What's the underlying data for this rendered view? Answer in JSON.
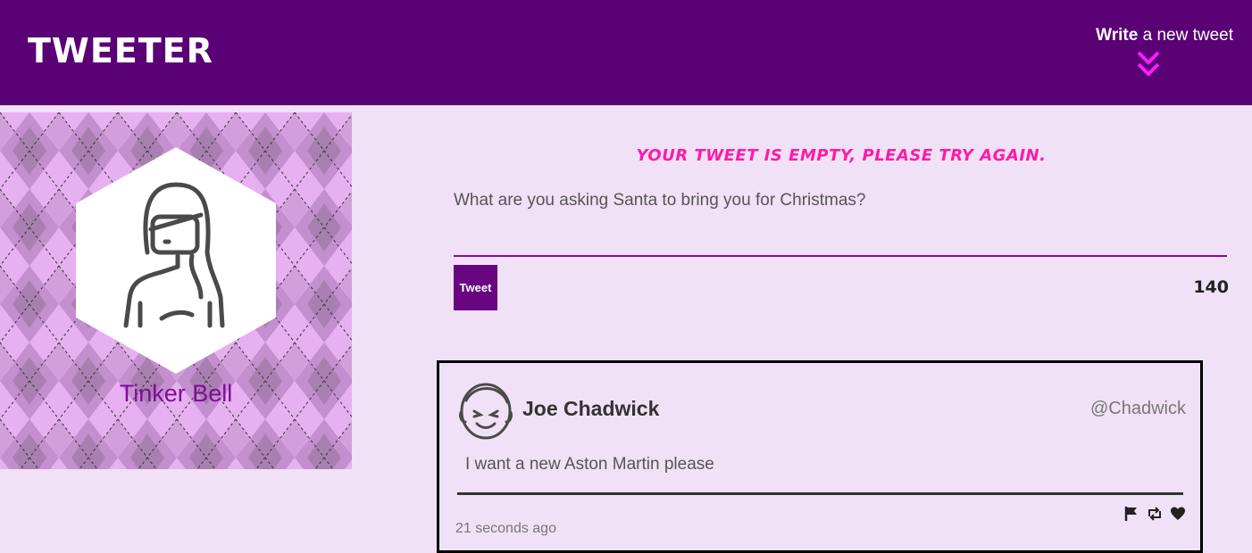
{
  "nav": {
    "brand": "TWEETER",
    "compose_bold": "Write",
    "compose_rest": " a new tweet"
  },
  "profile": {
    "name": "Tinker Bell"
  },
  "composer": {
    "error": "YOUR TWEET IS EMPTY, PLEASE TRY AGAIN.",
    "placeholder": "What are you asking Santa to bring you for Christmas?",
    "button_label": "Tweet",
    "counter": "140"
  },
  "tweets": [
    {
      "name": "Joe Chadwick",
      "handle": "@Chadwick",
      "body": "I want a new Aston Martin please",
      "time": "21 seconds ago"
    }
  ],
  "colors": {
    "nav_bg": "#5a0176",
    "page_bg": "#f1e1f6",
    "accent": "#7e0c9a",
    "error": "#ff1aa9",
    "chevron": "#ff1aff"
  }
}
